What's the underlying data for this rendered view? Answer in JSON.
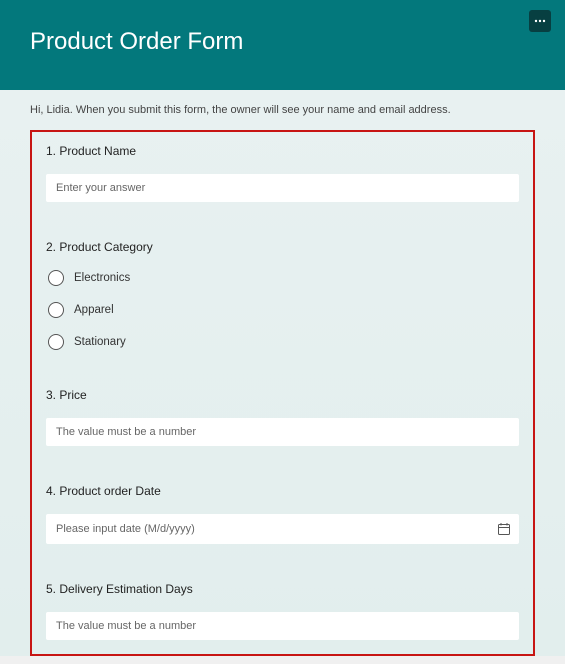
{
  "header": {
    "title": "Product Order Form"
  },
  "info_text": "Hi, Lidia. When you submit this form, the owner will see your name and email address.",
  "questions": [
    {
      "num": "1.",
      "label": "Product Name",
      "type": "text",
      "placeholder": "Enter your answer"
    },
    {
      "num": "2.",
      "label": "Product Category",
      "type": "radio",
      "options": [
        "Electronics",
        "Apparel",
        "Stationary"
      ]
    },
    {
      "num": "3.",
      "label": "Price",
      "type": "text",
      "placeholder": "The value must be a number"
    },
    {
      "num": "4.",
      "label": "Product order Date",
      "type": "date",
      "placeholder": "Please input date (M/d/yyyy)"
    },
    {
      "num": "5.",
      "label": "Delivery Estimation Days",
      "type": "text",
      "placeholder": "The value must be a number"
    }
  ]
}
